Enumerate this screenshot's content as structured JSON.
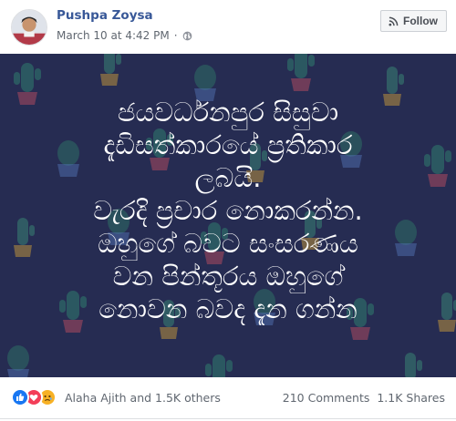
{
  "post": {
    "author": "Pushpa Zoysa",
    "timestamp": "March 10 at 4:42 PM",
    "separator": "·",
    "privacy_icon": "globe-icon",
    "follow_label": "Follow",
    "follow_icon": "rss-icon"
  },
  "image": {
    "background_color": "#262c52",
    "lines": [
      "ජයවර්ධනපුර සිසුවා",
      "දැඩිසත්කාරයේ ප්‍රතිකාර",
      "ලබයි.",
      "වැරදි ප්‍රචාර නොකරන්න.",
      "ඔහුගේ බවට සංසරණය",
      "වන පින්තූරය ඔහුගේ",
      "නොවන බවද දැන ගන්න"
    ]
  },
  "footer": {
    "reaction_icons": [
      "like-icon",
      "love-icon",
      "sad-icon"
    ],
    "reaction_names": "Alaha Ajith and 1.5K others",
    "comments": "210 Comments",
    "shares": "1.1K Shares"
  },
  "colors": {
    "author_link": "#385898",
    "like": "#1877f2",
    "love": "#f33e58",
    "sad": "#f7b125"
  }
}
